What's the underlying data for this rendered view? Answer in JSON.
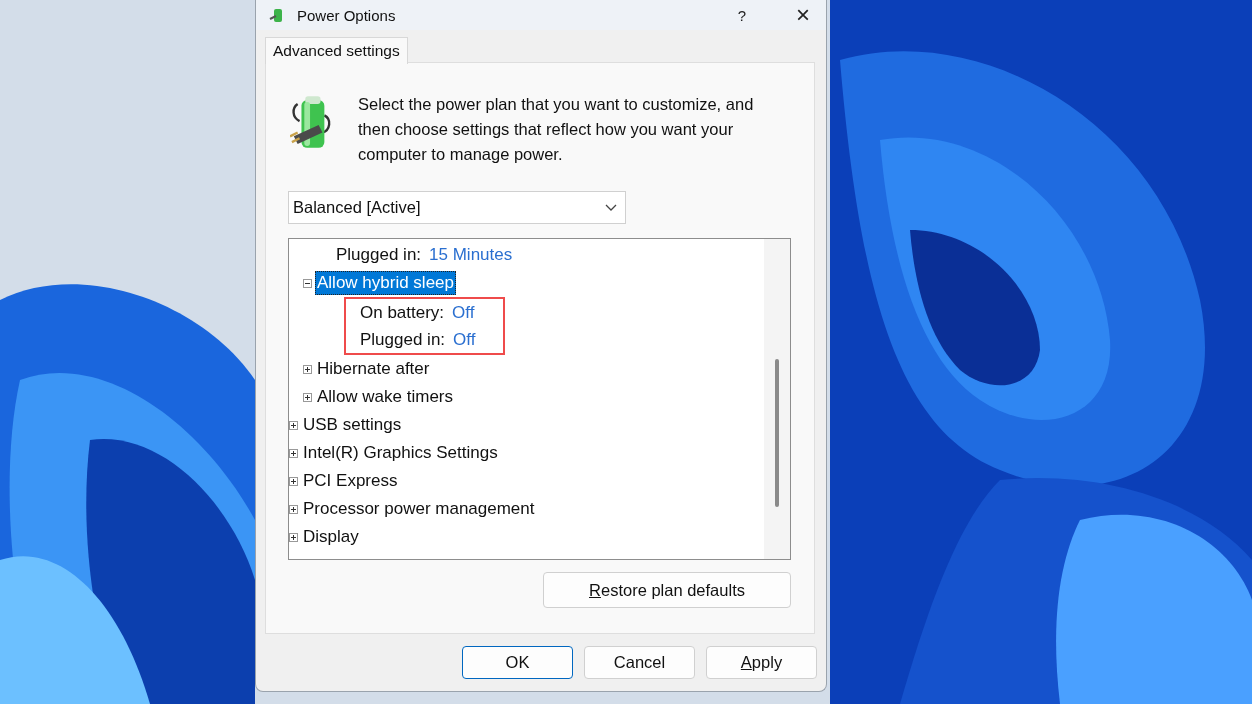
{
  "window": {
    "title": "Power Options",
    "help": "?",
    "close": "×"
  },
  "tabs": [
    {
      "label": "Advanced settings",
      "selected": true
    }
  ],
  "description": "Select the power plan that you want to customize, and then choose settings that reflect how you want your computer to manage power.",
  "plan_dropdown": {
    "value": "Balanced [Active]"
  },
  "tree": {
    "items": [
      {
        "children": [
          {
            "children": [
              {
                "label": "Plugged in:",
                "value": "15 Minutes"
              }
            ]
          },
          {
            "label": "Allow hybrid sleep",
            "expanded": true,
            "selected": true,
            "highlighted": true,
            "children": [
              {
                "label": "On battery:",
                "value": "Off"
              },
              {
                "label": "Plugged in:",
                "value": "Off"
              }
            ]
          },
          {
            "label": "Hibernate after",
            "expanded": false,
            "selected": false
          },
          {
            "label": "Allow wake timers",
            "expanded": false,
            "selected": false
          }
        ]
      },
      {
        "label": "USB settings",
        "expanded": false,
        "selected": false
      },
      {
        "label": "Intel(R) Graphics Settings",
        "expanded": false,
        "selected": false
      },
      {
        "label": "PCI Express",
        "expanded": false,
        "selected": false
      },
      {
        "label": "Processor power management",
        "expanded": false,
        "selected": false
      },
      {
        "label": "Display",
        "expanded": false,
        "selected": false
      }
    ]
  },
  "restore_button": {
    "label": "Restore plan defaults",
    "underline_first": true
  },
  "buttons": [
    {
      "label": "OK",
      "default": true,
      "underline_first": false
    },
    {
      "label": "Cancel",
      "default": false,
      "underline_first": false
    },
    {
      "label": "Apply",
      "default": false,
      "underline_first": true
    }
  ]
}
